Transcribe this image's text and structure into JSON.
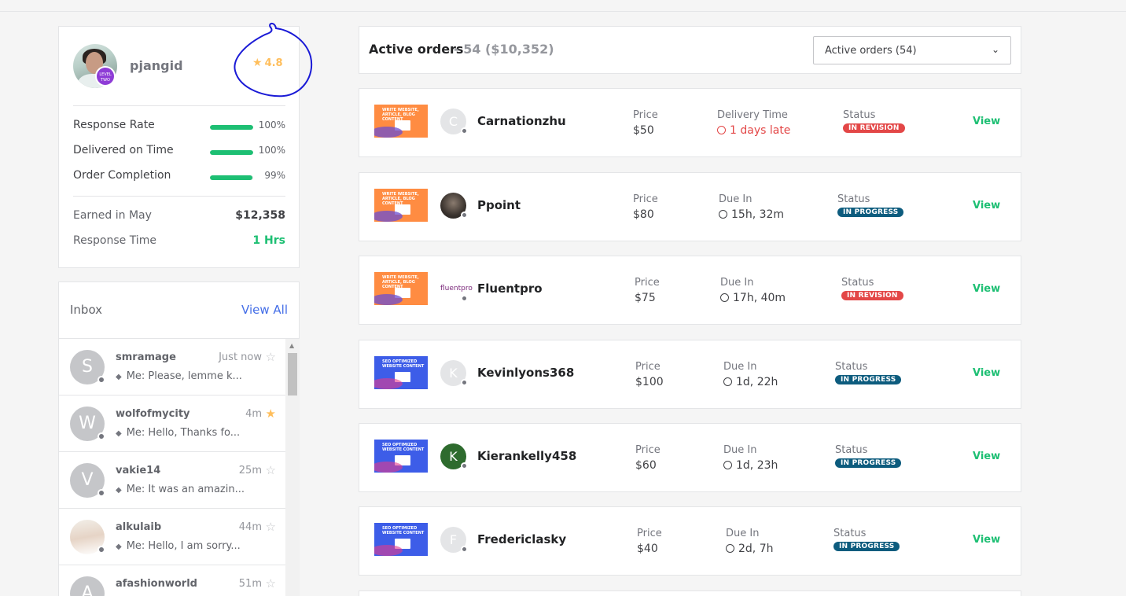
{
  "profile": {
    "username": "pjangid",
    "level_badge": "LEVEL TWO",
    "rating": "4.8",
    "metrics": [
      {
        "label": "Response Rate",
        "value": "100%",
        "progress": 1.0
      },
      {
        "label": "Delivered on Time",
        "value": "100%",
        "progress": 1.0
      },
      {
        "label": "Order Completion",
        "value": "99%",
        "progress": 0.99
      }
    ],
    "earned_label": "Earned in May",
    "earned_value": "$12,358",
    "response_time_label": "Response Time",
    "response_time_value": "1 Hrs",
    "colors": {
      "accent_green": "#1dbf73",
      "rating_yellow": "#ffbe5b",
      "level_purple": "#8e3cd6",
      "annotation_blue": "#1a1ad6"
    }
  },
  "inbox": {
    "title": "Inbox",
    "view_all": "View All",
    "messages": [
      {
        "initial": "S",
        "name": "smramage",
        "time": "Just now",
        "preview": "Me: Please, lemme k...",
        "starred": false
      },
      {
        "initial": "W",
        "name": "wolfofmycity",
        "time": "4m",
        "preview": "Me: Hello, Thanks fo...",
        "starred": true
      },
      {
        "initial": "V",
        "name": "vakie14",
        "time": "25m",
        "preview": "Me: It was an amazin...",
        "starred": false
      },
      {
        "initial": "",
        "name": "alkulaib",
        "time": "44m",
        "preview": "Me: Hello, I am sorry...",
        "starred": false
      },
      {
        "initial": "A",
        "name": "afashionworld",
        "time": "51m",
        "preview": "",
        "starred": false
      }
    ]
  },
  "orders_header": {
    "title": "Active orders",
    "count": "- 54 ($10,352)",
    "select_value": "Active orders (54)"
  },
  "orders": [
    {
      "thumb": "WRITE WEBSITE, ARTICLE, BLOG CONTENT",
      "initial": "C",
      "buyer": "Carnationzhu",
      "price_label": "Price",
      "price": "$50",
      "time_label": "Delivery Time",
      "time": "1 days late",
      "late": true,
      "status_label": "Status",
      "status": "IN REVISION",
      "view": "View"
    },
    {
      "thumb": "WRITE WEBSITE, ARTICLE, BLOG CONTENT",
      "initial": "",
      "buyer": "Ppoint",
      "price_label": "Price",
      "price": "$80",
      "time_label": "Due In",
      "time": "15h, 32m",
      "late": false,
      "status_label": "Status",
      "status": "IN PROGRESS",
      "view": "View"
    },
    {
      "thumb": "WRITE WEBSITE, ARTICLE, BLOG CONTENT",
      "initial": "fluentpro",
      "buyer": "Fluentpro",
      "price_label": "Price",
      "price": "$75",
      "time_label": "Due In",
      "time": "17h, 40m",
      "late": false,
      "status_label": "Status",
      "status": "IN REVISION",
      "view": "View"
    },
    {
      "thumb": "SEO OPTIMIZED WEBSITE CONTENT",
      "initial": "K",
      "buyer": "Kevinlyons368",
      "price_label": "Price",
      "price": "$100",
      "time_label": "Due In",
      "time": "1d, 22h",
      "late": false,
      "status_label": "Status",
      "status": "IN PROGRESS",
      "view": "View"
    },
    {
      "thumb": "SEO OPTIMIZED WEBSITE CONTENT",
      "initial": "K",
      "buyer": "Kierankelly458",
      "price_label": "Price",
      "price": "$60",
      "time_label": "Due In",
      "time": "1d, 23h",
      "late": false,
      "status_label": "Status",
      "status": "IN PROGRESS",
      "view": "View"
    },
    {
      "thumb": "SEO OPTIMIZED WEBSITE CONTENT",
      "initial": "F",
      "buyer": "Fredericlasky",
      "price_label": "Price",
      "price": "$40",
      "time_label": "Due In",
      "time": "2d, 7h",
      "late": false,
      "status_label": "Status",
      "status": "IN PROGRESS",
      "view": "View"
    }
  ]
}
